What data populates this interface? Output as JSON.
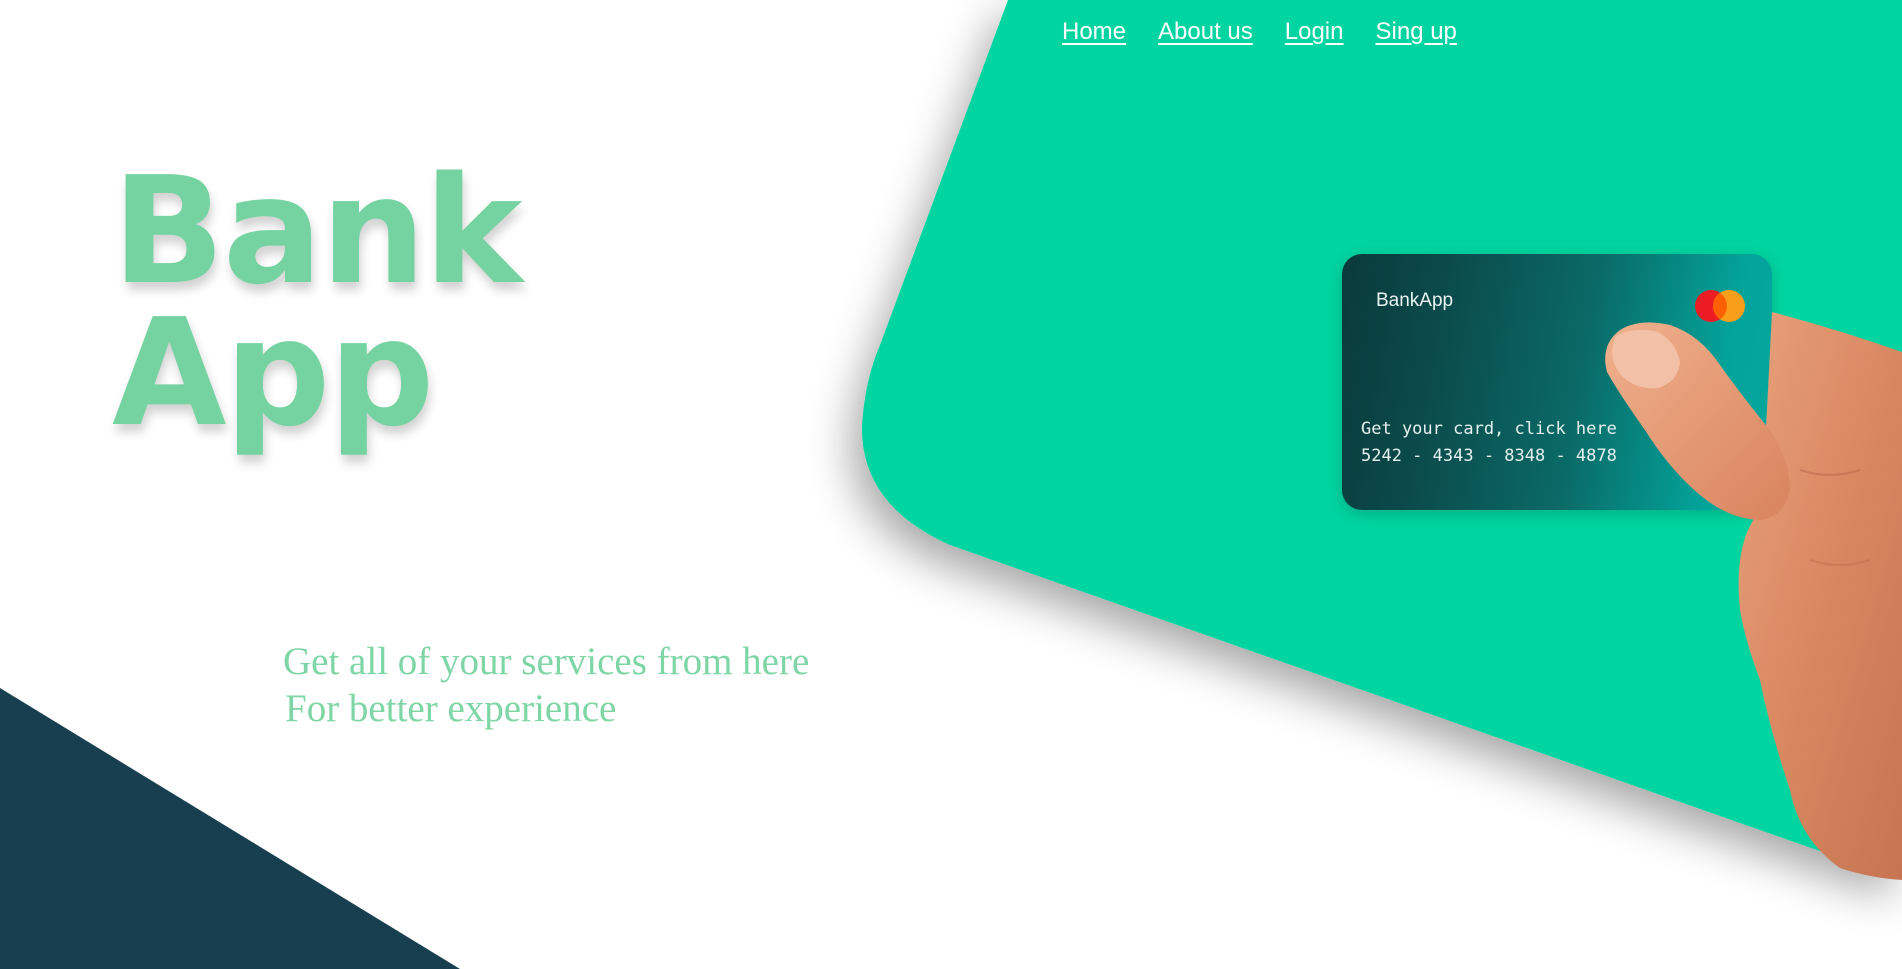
{
  "nav": {
    "items": [
      {
        "label": "Home"
      },
      {
        "label": "About us"
      },
      {
        "label": "Login"
      },
      {
        "label": "Sing up"
      }
    ]
  },
  "hero": {
    "title_line1": "Bank",
    "title_line2": "App",
    "tagline_line1": "Get all of your services from here",
    "tagline_line2": "For better experience"
  },
  "card": {
    "brand": "BankApp",
    "cta": "Get your card, click here",
    "number": "5242 - 4343 - 8348 - 4878",
    "logo_icon": "mastercard-icon"
  },
  "colors": {
    "accent_green": "#00d4a0",
    "title_green": "#74d3a1",
    "dark_navy": "#173f4f",
    "card_dark": "#0a3a3b",
    "card_teal": "#04a89e"
  }
}
